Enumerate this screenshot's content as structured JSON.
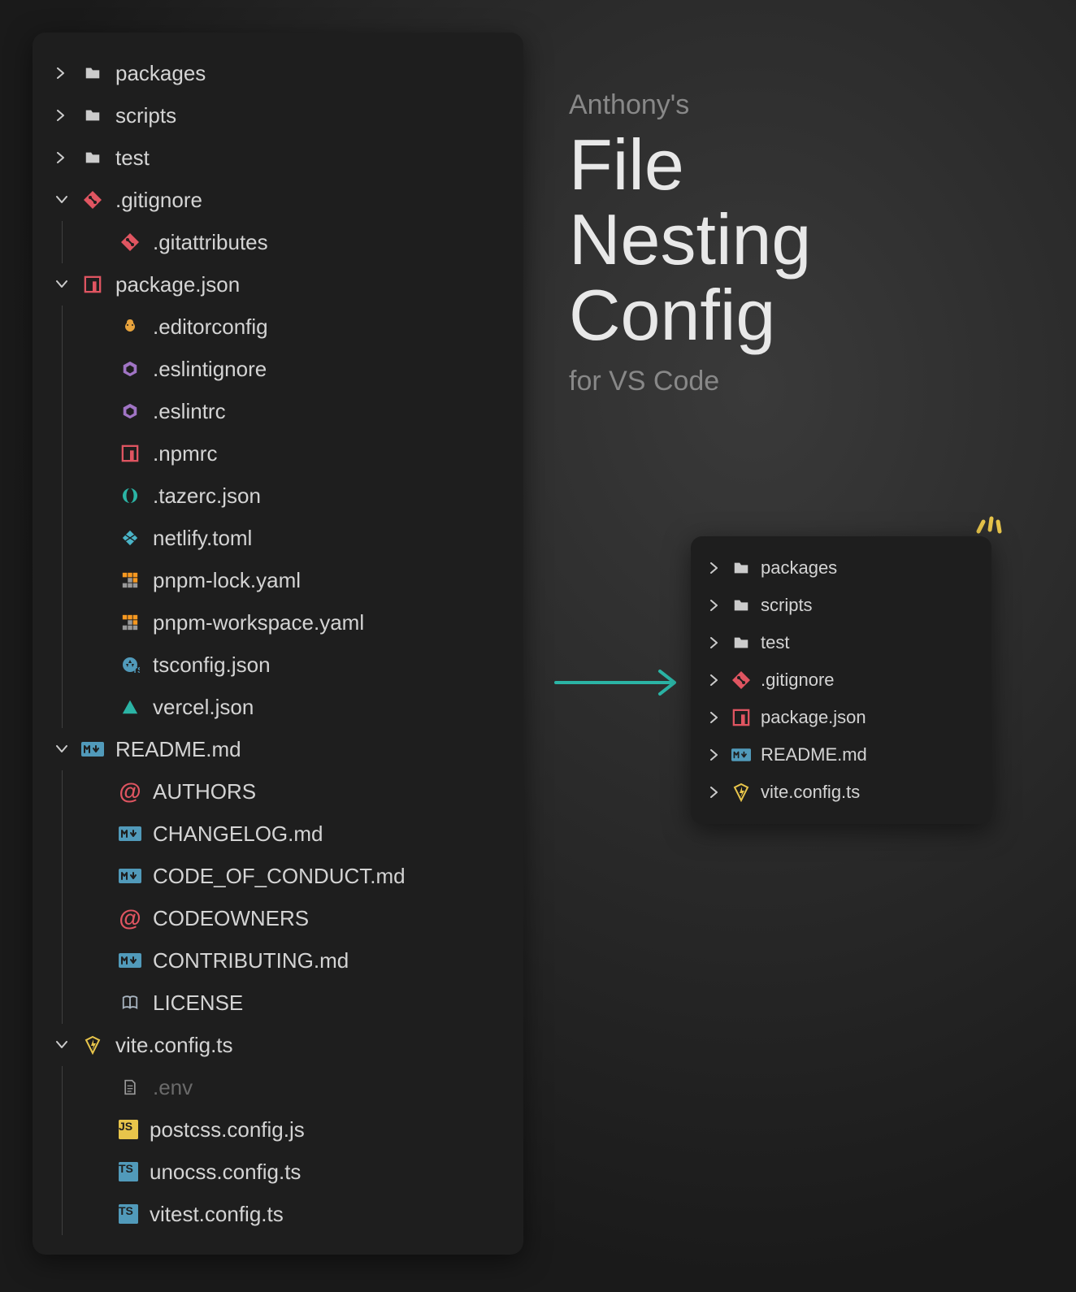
{
  "title": {
    "pre": "Anthony's",
    "line1": "File",
    "line2": "Nesting",
    "line3": "Config",
    "sub": "for VS Code"
  },
  "left_tree": [
    {
      "indent": 0,
      "chev": "right",
      "icon": "folder",
      "label": "packages"
    },
    {
      "indent": 0,
      "chev": "right",
      "icon": "folder",
      "label": "scripts"
    },
    {
      "indent": 0,
      "chev": "right",
      "icon": "folder",
      "label": "test"
    },
    {
      "indent": 0,
      "chev": "down",
      "icon": "git",
      "label": ".gitignore"
    },
    {
      "indent": 1,
      "chev": "",
      "icon": "git",
      "label": ".gitattributes"
    },
    {
      "indent": 0,
      "chev": "down",
      "icon": "npm",
      "label": "package.json"
    },
    {
      "indent": 1,
      "chev": "",
      "icon": "editorconfig",
      "label": ".editorconfig"
    },
    {
      "indent": 1,
      "chev": "",
      "icon": "eslint",
      "label": ".eslintignore"
    },
    {
      "indent": 1,
      "chev": "",
      "icon": "eslint",
      "label": ".eslintrc"
    },
    {
      "indent": 1,
      "chev": "",
      "icon": "npm",
      "label": ".npmrc"
    },
    {
      "indent": 1,
      "chev": "",
      "icon": "json-teal",
      "label": ".tazerc.json"
    },
    {
      "indent": 1,
      "chev": "",
      "icon": "netlify",
      "label": "netlify.toml"
    },
    {
      "indent": 1,
      "chev": "",
      "icon": "pnpm",
      "label": "pnpm-lock.yaml"
    },
    {
      "indent": 1,
      "chev": "",
      "icon": "pnpm",
      "label": "pnpm-workspace.yaml"
    },
    {
      "indent": 1,
      "chev": "",
      "icon": "tsconfig",
      "label": "tsconfig.json"
    },
    {
      "indent": 1,
      "chev": "",
      "icon": "vercel",
      "label": "vercel.json"
    },
    {
      "indent": 0,
      "chev": "down",
      "icon": "md",
      "label": "README.md"
    },
    {
      "indent": 1,
      "chev": "",
      "icon": "at",
      "label": "AUTHORS"
    },
    {
      "indent": 1,
      "chev": "",
      "icon": "md",
      "label": "CHANGELOG.md"
    },
    {
      "indent": 1,
      "chev": "",
      "icon": "md",
      "label": "CODE_OF_CONDUCT.md"
    },
    {
      "indent": 1,
      "chev": "",
      "icon": "at",
      "label": "CODEOWNERS"
    },
    {
      "indent": 1,
      "chev": "",
      "icon": "md",
      "label": "CONTRIBUTING.md"
    },
    {
      "indent": 1,
      "chev": "",
      "icon": "book",
      "label": "LICENSE"
    },
    {
      "indent": 0,
      "chev": "down",
      "icon": "vite",
      "label": "vite.config.ts"
    },
    {
      "indent": 1,
      "chev": "",
      "icon": "file",
      "label": ".env",
      "dim": true
    },
    {
      "indent": 1,
      "chev": "",
      "icon": "js",
      "label": "postcss.config.js"
    },
    {
      "indent": 1,
      "chev": "",
      "icon": "ts",
      "label": "unocss.config.ts"
    },
    {
      "indent": 1,
      "chev": "",
      "icon": "ts",
      "label": "vitest.config.ts"
    }
  ],
  "right_tree": [
    {
      "chev": "right",
      "icon": "folder",
      "label": "packages"
    },
    {
      "chev": "right",
      "icon": "folder",
      "label": "scripts"
    },
    {
      "chev": "right",
      "icon": "folder",
      "label": "test"
    },
    {
      "chev": "right",
      "icon": "git",
      "label": ".gitignore"
    },
    {
      "chev": "right",
      "icon": "npm",
      "label": "package.json"
    },
    {
      "chev": "right",
      "icon": "md",
      "label": "README.md"
    },
    {
      "chev": "right",
      "icon": "vite",
      "label": "vite.config.ts"
    }
  ]
}
